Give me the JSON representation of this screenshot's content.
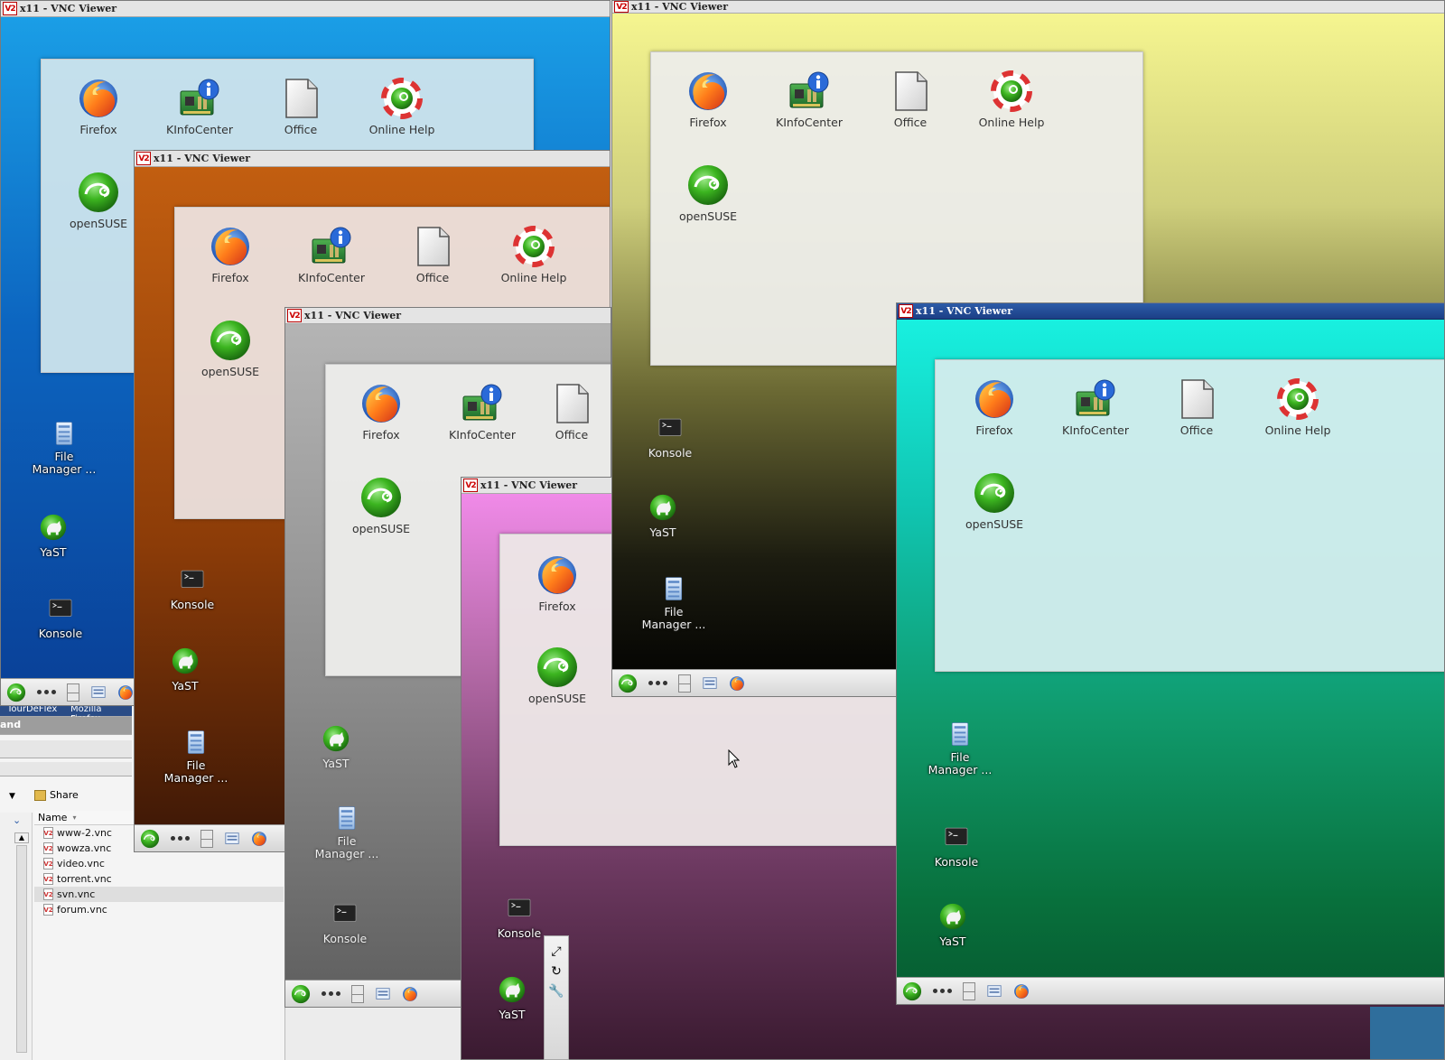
{
  "window_title": "x11 - VNC Viewer",
  "vnc_logo": "V2",
  "icons": {
    "firefox": "Firefox",
    "kinfocenter": "KInfoCenter",
    "office": "Office",
    "online_help": "Online Help",
    "opensuse": "openSUSE",
    "file_manager_1": "File",
    "file_manager_2": "Manager ...",
    "yast": "YaST",
    "konsole": "Konsole"
  },
  "taskbar": {
    "item1": "TourDeFlex",
    "item2": "Mozilla Firefox"
  },
  "file_manager": {
    "toolbar_label": "and",
    "share_label": "Share",
    "column_name": "Name",
    "files": [
      "www-2.vnc",
      "wowza.vnc",
      "video.vnc",
      "torrent.vnc",
      "svn.vnc",
      "forum.vnc"
    ],
    "selected_file": "svn.vnc"
  },
  "colors": {
    "blue_desktop": "#1a73c8",
    "orange_desktop": "#b4550e",
    "gray_desktop": "#9d9d9d",
    "pink_desktop": "#ee88e8",
    "yellow_desktop": "#eaea88",
    "teal_desktop": "#12e8d6",
    "active_titlebar": "#1c3f86"
  }
}
